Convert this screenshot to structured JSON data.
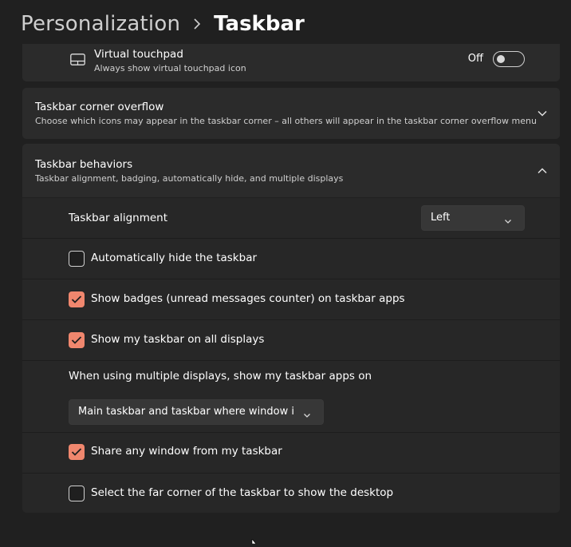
{
  "breadcrumb": {
    "parent": "Personalization",
    "current": "Taskbar"
  },
  "virtual_touchpad": {
    "icon": "touchpad-icon",
    "title": "Virtual touchpad",
    "subtitle": "Always show virtual touchpad icon",
    "toggle_label": "Off",
    "toggle_on": false
  },
  "corner_overflow": {
    "title": "Taskbar corner overflow",
    "subtitle": "Choose which icons may appear in the taskbar corner – all others will appear in the taskbar corner overflow menu",
    "expanded": false
  },
  "behaviors": {
    "title": "Taskbar behaviors",
    "subtitle": "Taskbar alignment, badging, automatically hide, and multiple displays",
    "expanded": true,
    "alignment": {
      "label": "Taskbar alignment",
      "value": "Left"
    },
    "auto_hide": {
      "label": "Automatically hide the taskbar",
      "checked": false
    },
    "badges": {
      "label": "Show badges (unread messages counter) on taskbar apps",
      "checked": true
    },
    "all_displays": {
      "label": "Show my taskbar on all displays",
      "checked": true
    },
    "multi_display": {
      "label": "When using multiple displays, show my taskbar apps on",
      "value": "Main taskbar and taskbar where window is c"
    },
    "share_window": {
      "label": "Share any window from my taskbar",
      "checked": true
    },
    "far_corner": {
      "label": "Select the far corner of the taskbar to show the desktop",
      "checked": false
    }
  },
  "colors": {
    "accent": "#f0876e",
    "background": "#202020",
    "card": "#2b2b2b"
  }
}
